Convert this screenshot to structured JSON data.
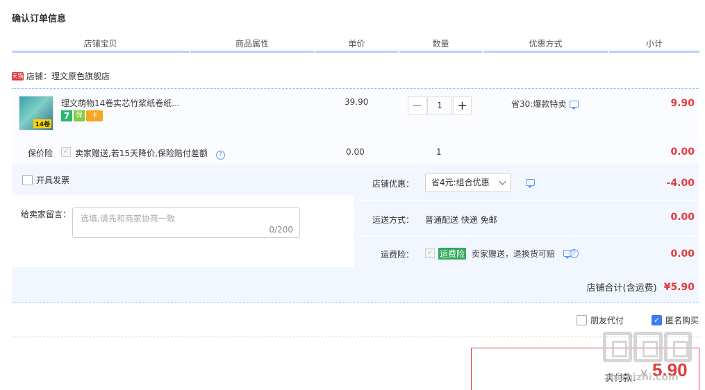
{
  "page_title": "确认订单信息",
  "columns": [
    "店铺宝贝",
    "商品属性",
    "单价",
    "数量",
    "优惠方式",
    "小计"
  ],
  "shop": {
    "badge": "天猫",
    "label": "店铺：理文原色旗舰店"
  },
  "item": {
    "title": "理文萌物14卷实芯竹浆纸卷纸...",
    "thumb_tag": "14卷",
    "badges": [
      "7",
      "保",
      "卡"
    ],
    "price": "39.90",
    "qty_minus": "−",
    "qty": "1",
    "qty_plus": "+",
    "promo": "省30:爆款特卖",
    "subtotal": "9.90"
  },
  "insurance": {
    "label": "保价险",
    "text": "卖家赠送,若15天降价,保险赔付差额",
    "price": "0.00",
    "qty": "1",
    "subtotal": "0.00"
  },
  "invoice_label": "开具发票",
  "message": {
    "label": "给卖家留言：",
    "placeholder": "选填,请先和商家协商一致",
    "count": "0/200"
  },
  "shop_discount": {
    "label": "店铺优惠：",
    "selected": "省4元:组合优惠",
    "value": "-4.00"
  },
  "shipping": {
    "label": "运送方式：",
    "text": "普通配送 快递 免邮",
    "value": "0.00"
  },
  "freight_ins": {
    "label": "运费险：",
    "tag": "运费险",
    "text": "卖家赠送，退换货可赔",
    "value": "0.00"
  },
  "shop_total": {
    "label": "店铺合计(含运费)",
    "value": "¥5.90"
  },
  "options": {
    "friend_pay": "朋友代付",
    "anonymous": "匿名购买"
  },
  "payment": {
    "label": "实付款：",
    "currency": "¥",
    "amount": "5.90"
  },
  "watermark": {
    "text": "zhizhizhi.com"
  },
  "colors": {
    "accent_red": "#e4393c",
    "header_blue": "#b2d1ff",
    "panel_bg": "#f2f7ff",
    "check_blue": "#3d7cf0"
  }
}
